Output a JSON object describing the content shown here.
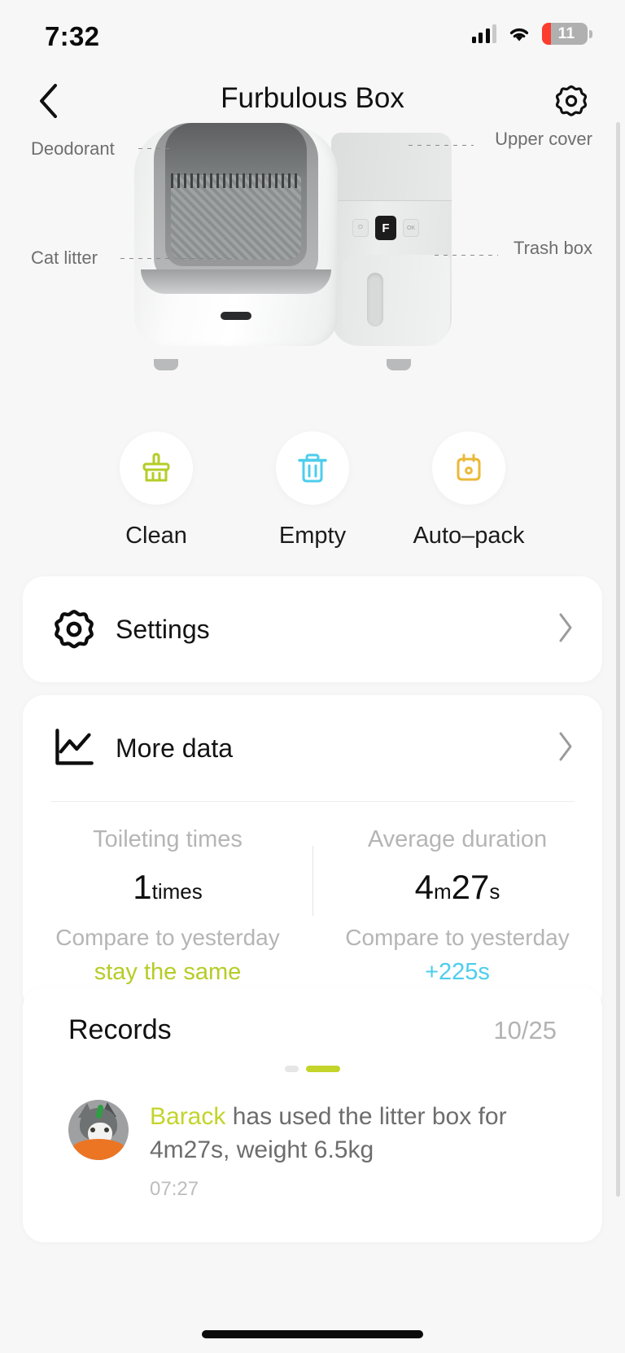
{
  "status_bar": {
    "time": "7:32",
    "battery_level": "11",
    "signal_icon": "cellular-signal-icon",
    "wifi_icon": "wifi-icon",
    "battery_icon": "battery-low-icon",
    "battery_fill_color": "#fc3d2e"
  },
  "nav": {
    "back_icon": "chevron-left-icon",
    "title": "Furbulous Box",
    "settings_icon": "gear-icon"
  },
  "device": {
    "labels": [
      {
        "text": "Deodorant",
        "position": "top-left"
      },
      {
        "text": "Upper cover",
        "position": "top-right"
      },
      {
        "text": "Cat litter",
        "position": "bottom-left"
      },
      {
        "text": "Trash box",
        "position": "bottom-right"
      }
    ],
    "brand_mark": "F"
  },
  "actions": [
    {
      "label": "Clean",
      "icon": "brush-icon",
      "color": "#b6cc28"
    },
    {
      "label": "Empty",
      "icon": "trash-icon",
      "color": "#4dcdec"
    },
    {
      "label": "Auto–pack",
      "icon": "auto-pack-bag-icon",
      "color": "#eab938"
    }
  ],
  "settings_row": {
    "label": "Settings",
    "icon": "gear-icon",
    "chevron": "chevron-right-icon"
  },
  "more_data_row": {
    "label": "More data",
    "icon": "line-chart-icon",
    "chevron": "chevron-right-icon"
  },
  "stats": [
    {
      "title": "Toileting times",
      "value_main": "1",
      "value_unit": "times",
      "compare_label": "Compare to yesterday",
      "delta": "stay the same",
      "delta_color": "#b6cc28"
    },
    {
      "title": "Average duration",
      "value_main": "4",
      "value_unit": "m",
      "value_main2": "27",
      "value_unit2": "s",
      "compare_label": "Compare to yesterday",
      "delta": "+225s",
      "delta_color": "#4dcdec"
    }
  ],
  "records": {
    "title": "Records",
    "date": "10/25",
    "pager": {
      "pages": 2,
      "active_index": 1,
      "active_color": "#c3d42a"
    },
    "items": [
      {
        "avatar": "cat-avatar",
        "name": "Barack",
        "name_color": "#c3d42a",
        "text": " has used the litter box for 4m27s, weight 6.5kg",
        "time": "07:27"
      }
    ]
  }
}
